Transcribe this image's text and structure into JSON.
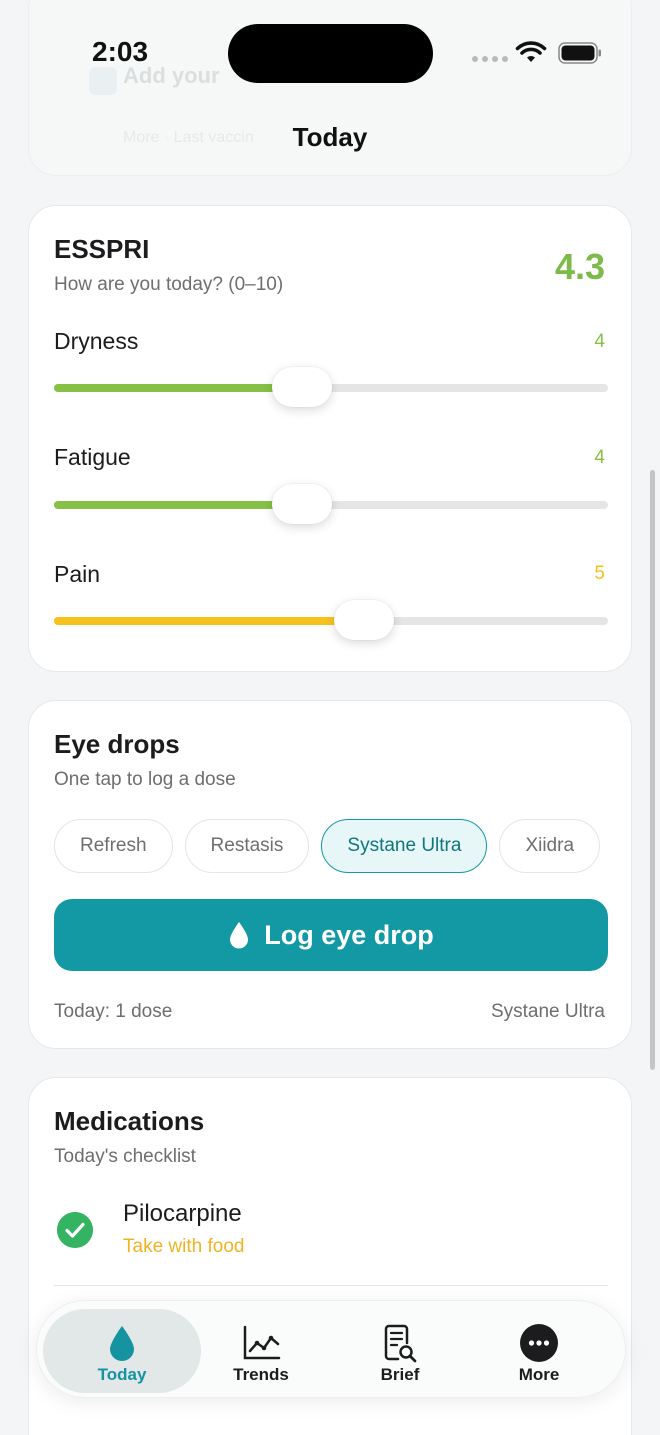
{
  "status_bar": {
    "time": "2:03"
  },
  "header": {
    "title": "Today"
  },
  "ghost": {
    "title": "Add your",
    "line1": "",
    "line2": "More · Last vaccin"
  },
  "esspri": {
    "title": "ESSPRI",
    "subtitle": "How are you today? (0–10)",
    "score": "4.3",
    "score_color": "#7cbb49",
    "sliders": [
      {
        "label": "Dryness",
        "value": "4",
        "fraction": 0.4,
        "color": "#86c145"
      },
      {
        "label": "Fatigue",
        "value": "4",
        "fraction": 0.4,
        "color": "#86c145"
      },
      {
        "label": "Pain",
        "value": "5",
        "fraction": 0.5,
        "color": "#f8c21c"
      }
    ]
  },
  "eye_drops": {
    "title": "Eye drops",
    "subtitle": "One tap to log a dose",
    "chips": [
      "Refresh",
      "Restasis",
      "Systane Ultra",
      "Xiidra"
    ],
    "selected_chip": "Systane Ultra",
    "button_label": "Log eye drop",
    "button_icon": "drop-icon",
    "footer_left": "Today: 1 dose",
    "footer_right": "Systane Ultra",
    "accent": "#1399a3"
  },
  "medications": {
    "title": "Medications",
    "subtitle": "Today's checklist",
    "items": [
      {
        "name": "Pilocarpine",
        "note": "Take with food",
        "checked": true
      }
    ]
  },
  "tabbar": {
    "tabs": [
      {
        "label": "Today",
        "icon": "drop-icon",
        "active": true
      },
      {
        "label": "Trends",
        "icon": "chart-icon",
        "active": false
      },
      {
        "label": "Brief",
        "icon": "document-search-icon",
        "active": false
      },
      {
        "label": "More",
        "icon": "more-icon",
        "active": false
      }
    ]
  }
}
